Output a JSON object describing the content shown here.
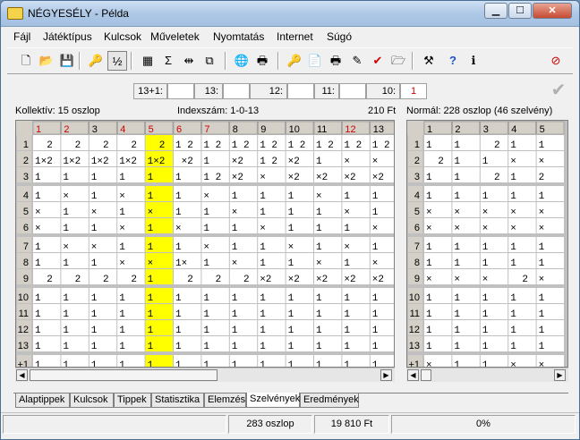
{
  "window": {
    "title": "NÉGYESÉLY - Példa",
    "controls": {
      "minimize": "▁",
      "maximize": "☐",
      "close": "✕"
    }
  },
  "menu": [
    "Fájl",
    "Játéktípus",
    "Kulcsok",
    "Műveletek",
    "Nyomtatás",
    "Internet",
    "Súgó"
  ],
  "toolbar": [
    {
      "name": "new-file-icon",
      "glyph": "🗋"
    },
    {
      "name": "open-folder-icon",
      "glyph": "📂"
    },
    {
      "name": "save-icon",
      "glyph": "💾"
    },
    {
      "name": "key-icon",
      "glyph": "🔑"
    },
    {
      "name": "x2-pattern-icon",
      "glyph": "½"
    },
    {
      "name": "calculator-icon",
      "glyph": "▦"
    },
    {
      "name": "sum-icon",
      "glyph": "Σ"
    },
    {
      "name": "align-icon",
      "glyph": "⇹"
    },
    {
      "name": "copy-icon",
      "glyph": "⧉"
    },
    {
      "name": "globe-icon",
      "glyph": "🌐"
    },
    {
      "name": "printer-icon",
      "glyph": "🖶"
    },
    {
      "name": "key-export-icon",
      "glyph": "🔑"
    },
    {
      "name": "document-export-icon",
      "glyph": "📄"
    },
    {
      "name": "print-setup-icon",
      "glyph": "🖶"
    },
    {
      "name": "eraser-icon",
      "glyph": "✎"
    },
    {
      "name": "check-icon",
      "glyph": "✔"
    },
    {
      "name": "folder-check-icon",
      "glyph": "🗁"
    },
    {
      "name": "tools-icon",
      "glyph": "⚒"
    },
    {
      "name": "help-icon",
      "glyph": "?"
    },
    {
      "name": "info-icon",
      "glyph": "ℹ"
    },
    {
      "name": "exit-icon",
      "glyph": "⊘"
    }
  ],
  "hits": [
    {
      "label": "13+1:",
      "value": ""
    },
    {
      "label": "13:",
      "value": ""
    },
    {
      "label": "12:",
      "value": ""
    },
    {
      "label": "11:",
      "value": ""
    },
    {
      "label": "10:",
      "value": "1"
    }
  ],
  "info": {
    "kollektiv": "Kollektív:  15 oszlop",
    "index": "Indexszám: 1-0-13",
    "price": "210 Ft",
    "normal": "Normál:  228 oszlop  (46 szelvény)"
  },
  "left_grid": {
    "columns": [
      "1",
      "2",
      "3",
      "4",
      "5",
      "6",
      "7",
      "8",
      "9",
      "10",
      "11",
      "12",
      "13"
    ],
    "red_columns": [
      1,
      2,
      4,
      5,
      6,
      7,
      12
    ],
    "highlight_column": 5,
    "row_labels": [
      "1",
      "2",
      "3",
      "4",
      "5",
      "6",
      "7",
      "8",
      "9",
      "10",
      "11",
      "12",
      "13",
      "+1"
    ],
    "rows": [
      [
        "  2",
        "  2",
        "  2",
        "  2",
        "  2",
        "1 2",
        "1 2",
        "1 2",
        "1 2",
        "1 2",
        "1 2",
        "1 2",
        "1 2"
      ],
      [
        "1×2",
        "1×2",
        "1×2",
        "1×2",
        "1×2",
        " ×2",
        "1  ",
        "×2",
        "1 2",
        "×2",
        "1  ",
        "× ",
        "× "
      ],
      [
        "1  ",
        "1  ",
        "1  ",
        "1  ",
        "1  ",
        "1  ",
        "1 2",
        "×2",
        "× ",
        "×2",
        "×2",
        "×2",
        "×2"
      ],
      [
        "1  ",
        "× ",
        "1  ",
        "× ",
        "1  ",
        "1  ",
        "× ",
        "1  ",
        "1  ",
        "1  ",
        "× ",
        "1  ",
        "1  "
      ],
      [
        "× ",
        "1  ",
        "× ",
        "1  ",
        "× ",
        "1  ",
        "1  ",
        "× ",
        "1  ",
        "1  ",
        "1  ",
        "× ",
        "1  "
      ],
      [
        "× ",
        "1  ",
        "1  ",
        "× ",
        "1  ",
        "× ",
        "1  ",
        "1  ",
        "× ",
        "1  ",
        "1  ",
        "1  ",
        "× "
      ],
      [
        "1  ",
        "× ",
        "× ",
        "1  ",
        "1  ",
        "1  ",
        "× ",
        "1  ",
        "1  ",
        "× ",
        "1  ",
        "× ",
        "1  "
      ],
      [
        "1  ",
        "1  ",
        "1  ",
        "× ",
        "× ",
        "1×",
        "1  ",
        "× ",
        "1  ",
        "1  ",
        "× ",
        "1  ",
        "× "
      ],
      [
        "  2",
        "  2",
        "  2",
        "  2",
        "1  ",
        "  2",
        "  2",
        "  2",
        "×2",
        "×2",
        "×2",
        "×2",
        "×2"
      ],
      [
        "1  ",
        "1  ",
        "1  ",
        "1  ",
        "1  ",
        "1  ",
        "1  ",
        "1  ",
        "1  ",
        "1  ",
        "1  ",
        "1  ",
        "1  "
      ],
      [
        "1  ",
        "1  ",
        "1  ",
        "1  ",
        "1  ",
        "1  ",
        "1  ",
        "1  ",
        "1  ",
        "1  ",
        "1  ",
        "1  ",
        "1  "
      ],
      [
        "1  ",
        "1  ",
        "1  ",
        "1  ",
        "1  ",
        "1  ",
        "1  ",
        "1  ",
        "1  ",
        "1  ",
        "1  ",
        "1  ",
        "1  "
      ],
      [
        "1  ",
        "1  ",
        "1  ",
        "1  ",
        "1  ",
        "1  ",
        "1  ",
        "1  ",
        "1  ",
        "1  ",
        "1  ",
        "1  ",
        "1  "
      ],
      [
        "1  ",
        "1  ",
        "1  ",
        "1  ",
        "1  ",
        "1  ",
        "1  ",
        "1  ",
        "1  ",
        "1  ",
        "1  ",
        "1  ",
        "1  "
      ]
    ]
  },
  "right_grid": {
    "columns": [
      "1",
      "2",
      "3",
      "4",
      "5"
    ],
    "row_labels": [
      "1",
      "2",
      "3",
      "4",
      "5",
      "6",
      "7",
      "8",
      "9",
      "10",
      "11",
      "12",
      "13",
      "+1"
    ],
    "rows": [
      [
        "1  ",
        "1  ",
        "  2",
        "1  ",
        "1  "
      ],
      [
        "  2",
        "1  ",
        "1  ",
        "× ",
        "× "
      ],
      [
        "1  ",
        "1  ",
        "  2",
        "1  ",
        "2 "
      ],
      [
        "1  ",
        "1  ",
        "1  ",
        "1  ",
        "1  "
      ],
      [
        "× ",
        "× ",
        "× ",
        "× ",
        "× "
      ],
      [
        "× ",
        "× ",
        "× ",
        "× ",
        "× "
      ],
      [
        "1  ",
        "1  ",
        "1  ",
        "1  ",
        "1  "
      ],
      [
        "1  ",
        "1  ",
        "1  ",
        "1  ",
        "1  "
      ],
      [
        "× ",
        "× ",
        "× ",
        "  2",
        "× "
      ],
      [
        "1  ",
        "1  ",
        "1  ",
        "1  ",
        "1  "
      ],
      [
        "1  ",
        "1  ",
        "1  ",
        "1  ",
        "1  "
      ],
      [
        "1  ",
        "1  ",
        "1  ",
        "1  ",
        "1  "
      ],
      [
        "1  ",
        "1  ",
        "1  ",
        "1  ",
        "1  "
      ],
      [
        "× ",
        "1  ",
        "1  ",
        "× ",
        "× "
      ]
    ]
  },
  "tabs": [
    "Alaptippek",
    "Kulcsok",
    "Tippek",
    "Statisztika",
    "Elemzés",
    "Szelvények",
    "Eredmények"
  ],
  "active_tab": "Szelvények",
  "status": {
    "empty": "",
    "columns": "283 oszlop",
    "price": "19 810 Ft",
    "percent": "0%"
  },
  "colors": {
    "highlight": "#ffff00",
    "header_red": "#cc0000",
    "grid_bg": "#c0c0c0",
    "cell_bg": "#ffffff"
  }
}
